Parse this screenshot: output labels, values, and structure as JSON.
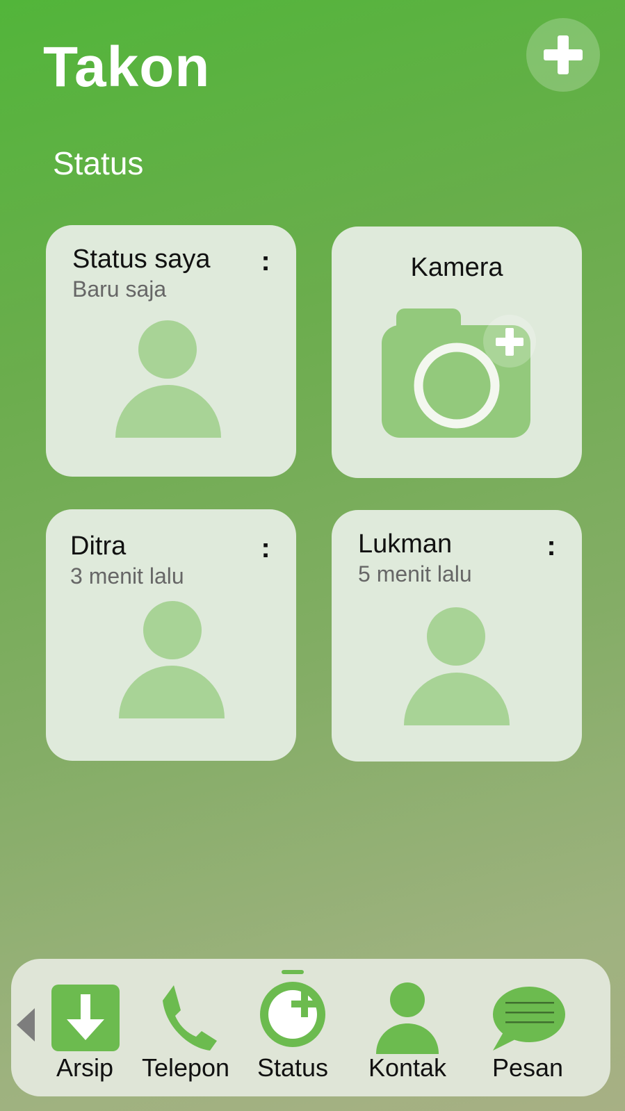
{
  "header": {
    "title": "Takon",
    "add_icon": "plus-icon"
  },
  "section": {
    "title": "Status"
  },
  "cards": {
    "mine": {
      "name": "Status saya",
      "time": "Baru saja",
      "menu": ":"
    },
    "camera": {
      "title": "Kamera",
      "icon": "camera-add-icon"
    },
    "ditra": {
      "name": "Ditra",
      "time": "3 menit lalu",
      "menu": ":"
    },
    "lukman": {
      "name": "Lukman",
      "time": "5 menit lalu",
      "menu": ":"
    }
  },
  "nav": {
    "items": [
      {
        "label": "Arsip",
        "icon": "archive-download-icon"
      },
      {
        "label": "Telepon",
        "icon": "phone-icon"
      },
      {
        "label": "Status",
        "icon": "status-add-icon",
        "active": true
      },
      {
        "label": "Kontak",
        "icon": "contact-icon"
      },
      {
        "label": "Pesan",
        "icon": "message-icon"
      }
    ]
  },
  "colors": {
    "brand_green": "#6cbb4f",
    "light_green": "#a8d396",
    "card_bg": "#dfeadb",
    "nav_bg": "#dfe5d7"
  }
}
